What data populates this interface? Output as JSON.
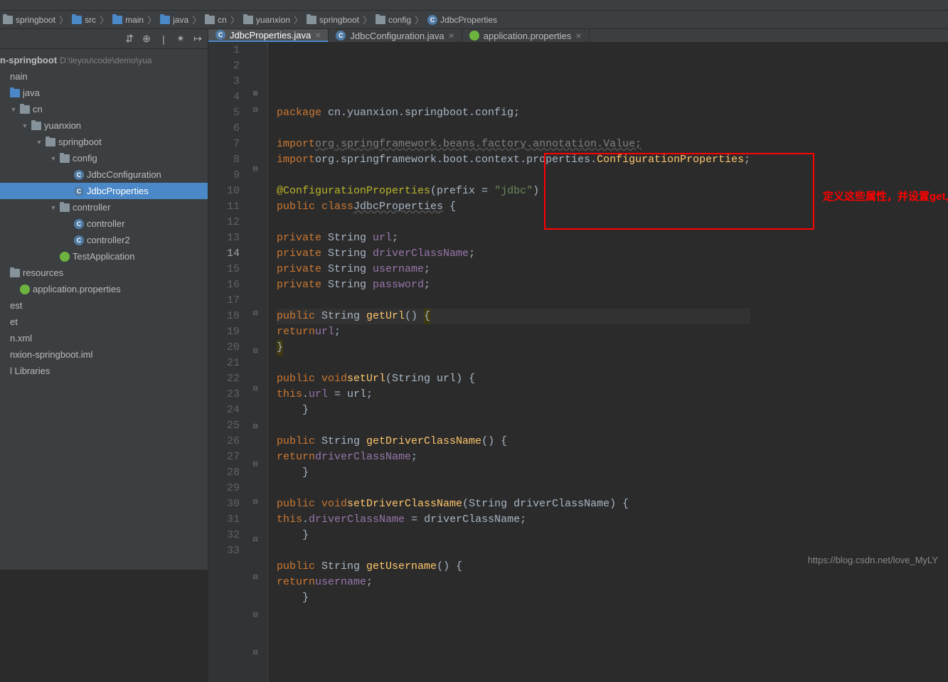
{
  "breadcrumbs": [
    {
      "type": "folder-gray",
      "label": "springboot"
    },
    {
      "type": "folder-blue",
      "label": "src"
    },
    {
      "type": "folder-blue",
      "label": "main"
    },
    {
      "type": "folder-blue",
      "label": "java"
    },
    {
      "type": "folder-gray",
      "label": "cn"
    },
    {
      "type": "folder-gray",
      "label": "yuanxion"
    },
    {
      "type": "folder-gray",
      "label": "springboot"
    },
    {
      "type": "folder-gray",
      "label": "config"
    },
    {
      "type": "class",
      "label": "JdbcProperties"
    }
  ],
  "tabs": [
    {
      "icon": "class",
      "label": "JdbcProperties.java",
      "active": true
    },
    {
      "icon": "class",
      "label": "JdbcConfiguration.java",
      "active": false
    },
    {
      "icon": "prop",
      "label": "application.properties",
      "active": false
    }
  ],
  "tree_header_path": "D:\\leyou\\code\\demo\\yua",
  "tree_header_name": "n-springboot",
  "tree": [
    {
      "indent": 0,
      "toggle": "",
      "icon": "",
      "label": "nain"
    },
    {
      "indent": 0,
      "toggle": "",
      "icon": "folder-blue",
      "label": "java"
    },
    {
      "indent": 1,
      "toggle": "▼",
      "icon": "folder-gray",
      "label": "cn"
    },
    {
      "indent": 2,
      "toggle": "▼",
      "icon": "folder-gray",
      "label": "yuanxion"
    },
    {
      "indent": 3,
      "toggle": "▼",
      "icon": "folder-gray",
      "label": "springboot"
    },
    {
      "indent": 4,
      "toggle": "▼",
      "icon": "folder-gray",
      "label": "config"
    },
    {
      "indent": 5,
      "toggle": "",
      "icon": "class",
      "label": "JdbcConfiguration"
    },
    {
      "indent": 5,
      "toggle": "",
      "icon": "class",
      "label": "JdbcProperties",
      "selected": true
    },
    {
      "indent": 4,
      "toggle": "▼",
      "icon": "folder-gray",
      "label": "controller"
    },
    {
      "indent": 5,
      "toggle": "",
      "icon": "class",
      "label": "controller"
    },
    {
      "indent": 5,
      "toggle": "",
      "icon": "class",
      "label": "controller2"
    },
    {
      "indent": 4,
      "toggle": "",
      "icon": "spring",
      "label": "TestApplication"
    },
    {
      "indent": 0,
      "toggle": "",
      "icon": "folder-gray",
      "label": "resources"
    },
    {
      "indent": 1,
      "toggle": "",
      "icon": "prop",
      "label": "application.properties"
    },
    {
      "indent": 0,
      "toggle": "",
      "icon": "",
      "label": "est"
    },
    {
      "indent": 0,
      "toggle": "",
      "icon": "",
      "label": "et"
    },
    {
      "indent": 0,
      "toggle": "",
      "icon": "",
      "label": "n.xml"
    },
    {
      "indent": 0,
      "toggle": "",
      "icon": "",
      "label": "nxion-springboot.iml"
    },
    {
      "indent": 0,
      "toggle": "",
      "icon": "",
      "label": "l Libraries"
    }
  ],
  "annotation": "定义这些属性，并设置get,set方法",
  "watermark": "https://blog.csdn.net/love_MyLY",
  "code": {
    "lines": [
      {
        "n": 1,
        "html": "<span class='kw'>package</span> cn.yuanxion.springboot.config;"
      },
      {
        "n": 2,
        "html": ""
      },
      {
        "n": 3,
        "html": "<span class='kw'>import</span> <span class='import-gray'>org.springframework.beans.factory.annotation.Value;</span>",
        "fold": "+"
      },
      {
        "n": 4,
        "html": "<span class='kw'>import</span> <span class='import-class'>org.springframework.boot.context.properties.</span><span class='cls'>ConfigurationProperties</span>;",
        "fold": "-"
      },
      {
        "n": 5,
        "html": ""
      },
      {
        "n": 6,
        "html": "<span class='annotation'>@ConfigurationProperties</span>(prefix = <span class='str'>\"jdbc\"</span>)"
      },
      {
        "n": 7,
        "html": "<span class='kw'>public class</span> <span style='text-decoration:underline wavy #555'>JdbcProperties</span> {",
        "fold": "-"
      },
      {
        "n": 8,
        "html": ""
      },
      {
        "n": 9,
        "html": "    <span class='kw'>private</span> String <span class='ident'>url</span>;"
      },
      {
        "n": 10,
        "html": "    <span class='kw'>private</span> String <span class='ident'>driverClassName</span>;"
      },
      {
        "n": 11,
        "html": "    <span class='kw'>private</span> String <span class='ident'>username</span>;"
      },
      {
        "n": 12,
        "html": "    <span class='kw'>private</span> String <span class='ident'>password</span>;"
      },
      {
        "n": 13,
        "html": ""
      },
      {
        "n": 14,
        "html": "    <span class='kw'>public</span> String <span class='cls'>getUrl</span>() <span style='background:#3d3910'>{</span>",
        "hl": true,
        "fold": "-"
      },
      {
        "n": 15,
        "html": "        <span class='kw'>return</span> <span class='ident'>url</span>;"
      },
      {
        "n": 16,
        "html": "    <span style='background:#3d3910'>}</span>",
        "fold": "-"
      },
      {
        "n": 17,
        "html": ""
      },
      {
        "n": 18,
        "html": "    <span class='kw'>public void</span> <span class='cls'>setUrl</span>(String url) {",
        "fold": "-"
      },
      {
        "n": 19,
        "html": "        <span class='kw'>this</span>.<span class='ident'>url</span> = url;"
      },
      {
        "n": 20,
        "html": "    }",
        "fold": "-"
      },
      {
        "n": 21,
        "html": ""
      },
      {
        "n": 22,
        "html": "    <span class='kw'>public</span> String <span class='cls'>getDriverClassName</span>() {",
        "fold": "-"
      },
      {
        "n": 23,
        "html": "        <span class='kw'>return</span> <span class='ident'>driverClassName</span>;"
      },
      {
        "n": 24,
        "html": "    }",
        "fold": "-"
      },
      {
        "n": 25,
        "html": ""
      },
      {
        "n": 26,
        "html": "    <span class='kw'>public void</span> <span class='cls'>setDriverClassName</span>(String driverClassName) {",
        "fold": "-"
      },
      {
        "n": 27,
        "html": "        <span class='kw'>this</span>.<span class='ident'>driverClassName</span> = driverClassName;"
      },
      {
        "n": 28,
        "html": "    }",
        "fold": "-"
      },
      {
        "n": 29,
        "html": ""
      },
      {
        "n": 30,
        "html": "    <span class='kw'>public</span> String <span class='cls'>getUsername</span>() {",
        "fold": "-"
      },
      {
        "n": 31,
        "html": "        <span class='kw'>return</span> <span class='ident'>username</span>;"
      },
      {
        "n": 32,
        "html": "    }",
        "fold": "-"
      },
      {
        "n": 33,
        "html": ""
      }
    ]
  }
}
